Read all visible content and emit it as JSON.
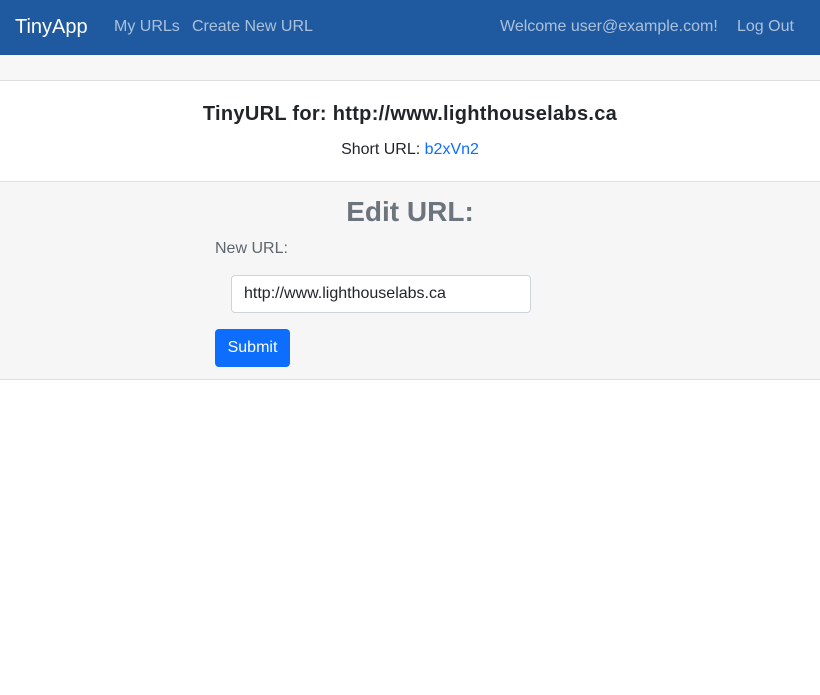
{
  "navbar": {
    "brand": "TinyApp",
    "links": [
      {
        "label": "My URLs"
      },
      {
        "label": "Create New URL"
      }
    ],
    "welcome": "Welcome user@example.com!",
    "logout": "Log Out",
    "bg_color": "#1f5aa0"
  },
  "url_card": {
    "title": "TinyURL for: http://www.lighthouselabs.ca",
    "short_label": "Short URL:",
    "short_url": "b2xVn2"
  },
  "edit": {
    "title": "Edit URL:",
    "field_label": "New URL:",
    "field_value": "http://www.lighthouselabs.ca",
    "submit_label": "Submit",
    "accent_color": "#0d6efd"
  }
}
